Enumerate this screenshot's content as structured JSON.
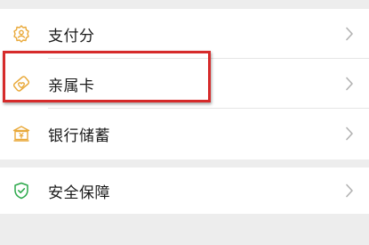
{
  "menu": {
    "group1": [
      {
        "label": "支付分",
        "icon": "payscore-icon"
      },
      {
        "label": "亲属卡",
        "icon": "family-card-icon"
      },
      {
        "label": "银行储蓄",
        "icon": "bank-icon"
      }
    ],
    "group2": [
      {
        "label": "安全保障",
        "icon": "shield-check-icon"
      }
    ]
  },
  "colors": {
    "accent_icon": "#E9A93A",
    "security_icon": "#2BA84A",
    "highlight_border": "#D62B2B",
    "chevron": "#B2B2B2"
  }
}
